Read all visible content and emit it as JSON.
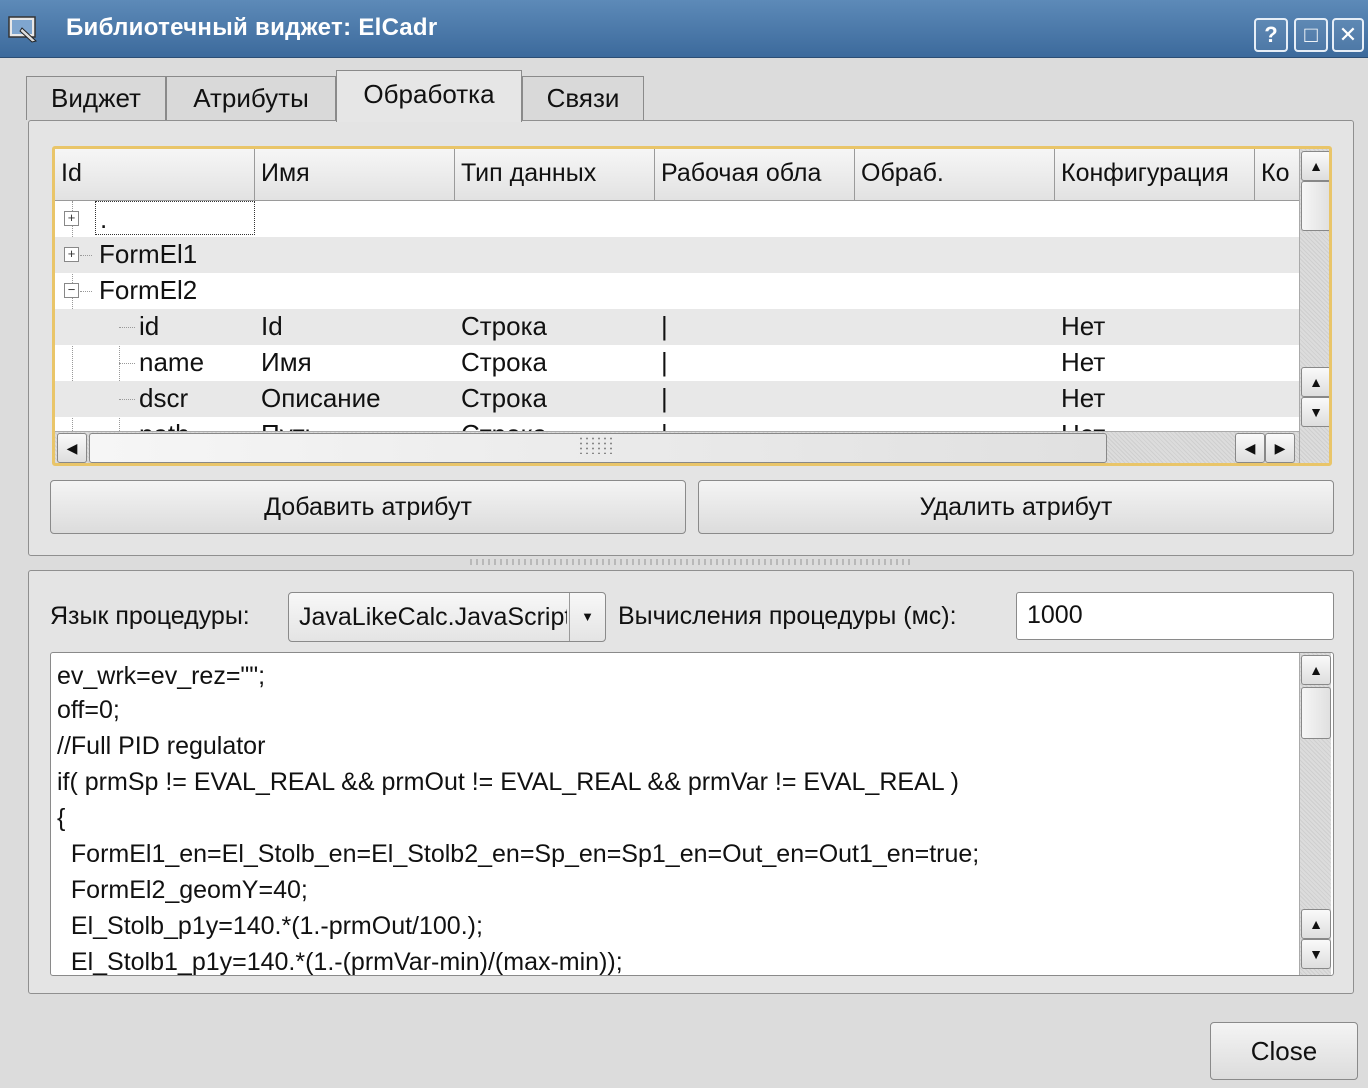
{
  "window": {
    "title": "Библиотечный виджет: ElCadr",
    "help_label": "?",
    "maximize_label": "□",
    "close_label": "✕"
  },
  "tabs": [
    {
      "label": "Виджет"
    },
    {
      "label": "Атрибуты"
    },
    {
      "label": "Обработка"
    },
    {
      "label": "Связи"
    }
  ],
  "attr_table": {
    "columns": [
      "Id",
      "Имя",
      "Тип данных",
      "Рабочая обла",
      "Обраб.",
      "Конфигурация",
      "Ко"
    ],
    "rows": [
      {
        "id": ".",
        "name": "",
        "type": "",
        "work": "",
        "proc": "",
        "config": "",
        "expander": "+"
      },
      {
        "id": "FormEl1",
        "name": "",
        "type": "",
        "work": "",
        "proc": "",
        "config": "",
        "expander": "+"
      },
      {
        "id": "FormEl2",
        "name": "",
        "type": "",
        "work": "",
        "proc": "",
        "config": "",
        "expander": "−"
      },
      {
        "id": "id",
        "name": "Id",
        "type": "Строка",
        "work": "|",
        "proc": "",
        "config": "Нет"
      },
      {
        "id": "name",
        "name": "Имя",
        "type": "Строка",
        "work": "|",
        "proc": "",
        "config": "Нет"
      },
      {
        "id": "dscr",
        "name": "Описание",
        "type": "Строка",
        "work": "|",
        "proc": "",
        "config": "Нет"
      },
      {
        "id": "path",
        "name": "Путь",
        "type": "Строка",
        "work": "|",
        "proc": "",
        "config": "Нет"
      }
    ]
  },
  "buttons": {
    "add_attr": "Добавить атрибут",
    "del_attr": "Удалить атрибут",
    "close": "Close"
  },
  "procedure": {
    "lang_label": "Язык процедуры:",
    "lang_value": "JavaLikeCalc.JavaScript",
    "calc_label": "Вычисления процедуры (мс):",
    "calc_value": "1000"
  },
  "code": [
    "ev_wrk=ev_rez=\"\";",
    "off=0;",
    "//Full PID regulator",
    "if( prmSp != EVAL_REAL && prmOut != EVAL_REAL && prmVar != EVAL_REAL )",
    "{",
    "  FormEl1_en=El_Stolb_en=El_Stolb2_en=Sp_en=Sp1_en=Out_en=Out1_en=true;",
    "  FormEl2_geomY=40;",
    "  El_Stolb_p1y=140.*(1.-prmOut/100.);",
    "  El_Stolb1_p1y=140.*(1.-(prmVar-min)/(max-min));"
  ]
}
